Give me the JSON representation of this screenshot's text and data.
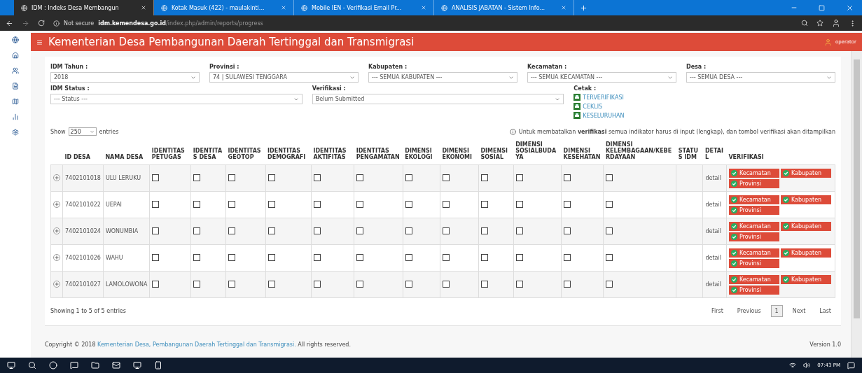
{
  "browser": {
    "tabs": [
      {
        "title": "IDM : Indeks Desa Membangun",
        "selected": true
      },
      {
        "title": "Kotak Masuk (422) - maulakinti...",
        "selected": false
      },
      {
        "title": "Mobile IEN - Verifikasi Email Pr...",
        "selected": false
      },
      {
        "title": "ANALISIS JABATAN - Sistem Info...",
        "selected": false
      }
    ],
    "security": "Not secure",
    "host": "idm.kemendesa.go.id",
    "path": "/index.php/admin/reports/progress"
  },
  "header": {
    "title": "Kementerian Desa Pembangunan Daerah Tertinggal dan Transmigrasi",
    "user": "operator"
  },
  "filters": [
    {
      "label": "IDM Tahun :",
      "value": "2018"
    },
    {
      "label": "Provinsi :",
      "value": "74 | SULAWESI TENGGARA"
    },
    {
      "label": "Kabupaten :",
      "value": "--- SEMUA KABUPATEN ---"
    },
    {
      "label": "Kecamatan :",
      "value": "--- SEMUA KECAMATAN ---"
    },
    {
      "label": "Desa :",
      "value": "--- SEMUA DESA ---"
    }
  ],
  "filters_2": [
    {
      "label": "IDM Status :",
      "value": "--- Status ---"
    },
    {
      "label": "Verifikasi :",
      "value": "Belum Submitted"
    }
  ],
  "cetak": {
    "label": "Cetak :",
    "links": [
      "TERVERIFIKASI",
      "CEKLIS",
      "KESELURUHAN"
    ]
  },
  "table": {
    "show_label": "Show",
    "show_value": "250",
    "entries_label": "entries",
    "note": "Untuk membatalkan **verifikasi** semua indikator harus di input (lengkap), dan tombol verifikasi akan ditampilkan",
    "columns": [
      "ID DESA",
      "NAMA DESA",
      "IDENTITAS PETUGAS",
      "IDENTITAS DESA",
      "IDENTITAS GEOTOP",
      "IDENTITAS DEMOGRAFI",
      "IDENTITAS AKTIFITAS",
      "IDENTITAS PENGAMATAN",
      "DIMENSI EKOLOGI",
      "DIMENSI EKONOMI",
      "DIMENSI SOSIAL",
      "DIMENSI SOSIALBUDAYA",
      "DIMENSI KESEHATAN",
      "DIMENSI KELEMBAGAAN/KEBERDAYAAN",
      "STATUS IDM",
      "DETAIL",
      "VERIFIKASI"
    ],
    "rows": [
      {
        "id": "7402101018",
        "name": "ULU LERUKU",
        "checks": [
          false,
          false,
          false,
          false,
          false,
          false,
          false,
          false,
          false,
          false,
          false,
          false
        ],
        "detail": "detail",
        "buttons": [
          "Kecamatan",
          "Kabupaten",
          "Provinsi"
        ]
      },
      {
        "id": "7402101022",
        "name": "UEPAI",
        "checks": [
          false,
          false,
          false,
          false,
          false,
          false,
          false,
          false,
          false,
          false,
          false,
          false
        ],
        "detail": "detail",
        "buttons": [
          "Kecamatan",
          "Kabupaten",
          "Provinsi"
        ]
      },
      {
        "id": "7402101024",
        "name": "WONUMBIA",
        "checks": [
          false,
          false,
          false,
          false,
          false,
          false,
          false,
          false,
          false,
          false,
          false,
          false
        ],
        "detail": "detail",
        "buttons": [
          "Kecamatan",
          "Kabupaten",
          "Provinsi"
        ]
      },
      {
        "id": "7402101026",
        "name": "WAHU",
        "checks": [
          false,
          false,
          false,
          false,
          false,
          false,
          false,
          false,
          false,
          false,
          false,
          false
        ],
        "detail": "detail",
        "buttons": [
          "Kecamatan",
          "Kabupaten",
          "Provinsi"
        ]
      },
      {
        "id": "7402101027",
        "name": "LAMOLOWONA",
        "checks": [
          false,
          false,
          false,
          false,
          false,
          false,
          false,
          false,
          false,
          false,
          false,
          false
        ],
        "detail": "detail",
        "buttons": [
          "Kecamatan",
          "Kabupaten",
          "Provinsi"
        ]
      }
    ],
    "info": "Showing 1 to 5 of 5 entries",
    "pages": [
      {
        "label": "First",
        "selected": false
      },
      {
        "label": "Previous",
        "selected": false
      },
      {
        "label": "1",
        "selected": true
      },
      {
        "label": "Next",
        "selected": false
      },
      {
        "label": "Last",
        "selected": false
      }
    ]
  },
  "footer": {
    "copyright": "Copyright © 2018 ",
    "owner": "Kementerian Desa, Pembangunan Daerah Tertinggal dan Transmigrasi.",
    "rights": " All rights reserved.",
    "version": "Version 1.0"
  },
  "taskbar": {
    "time": "07:43 PM"
  }
}
